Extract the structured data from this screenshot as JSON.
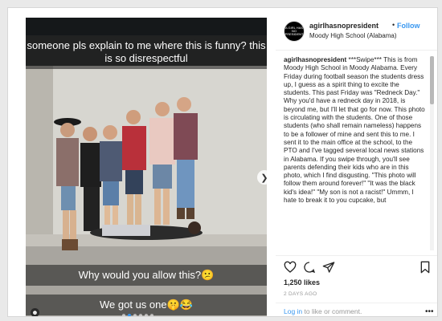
{
  "post": {
    "captions": {
      "top": "someone pls explain to me where this is funny? this is so disrespectful",
      "middle": "Why would you allow this?😕",
      "bottom": "We got us one🤫😂"
    },
    "carousel": {
      "total": 6,
      "active_index": 1
    }
  },
  "header": {
    "avatar_text": "A GIRL HAS NO PRESIDENT",
    "username": "agirlhasnopresident",
    "separator": "•",
    "follow_label": "Follow",
    "location": "Moody High School (Alabama)"
  },
  "caption": {
    "username": "agirlhasnopresident",
    "text": " ***Swipe*** This is from Moody High School in Moody Alabama. Every Friday during football season the students dress up, I guess as a spirit thing to excite the students. This past Friday was \"Redneck Day.\" Why you'd have a redneck day in 2018, is beyond me, but I'll let that go for now. This photo is circulating with the students. One of those students (who shall remain nameless) happens to be a follower of mine and sent this to me. I sent it to the main office at the school, to the PTO and I've tagged several local news stations in Alabama. If you swipe through, you'll see parents defending their kids who are in this photo, which I find disgusting. \"This photo will follow them around forever!\" \"It was the black kid's idea!\" \"My son is not a racist!\" Ummm, I hate to break it to you cupcake, but"
  },
  "stats": {
    "likes": "1,250 likes",
    "time_ago": "2 DAYS AGO"
  },
  "footer": {
    "login_link": "Log in",
    "login_rest": " to like or comment.",
    "more": "•••"
  },
  "colors": {
    "accent": "#3897f0",
    "text": "#262626",
    "muted": "#999999"
  }
}
